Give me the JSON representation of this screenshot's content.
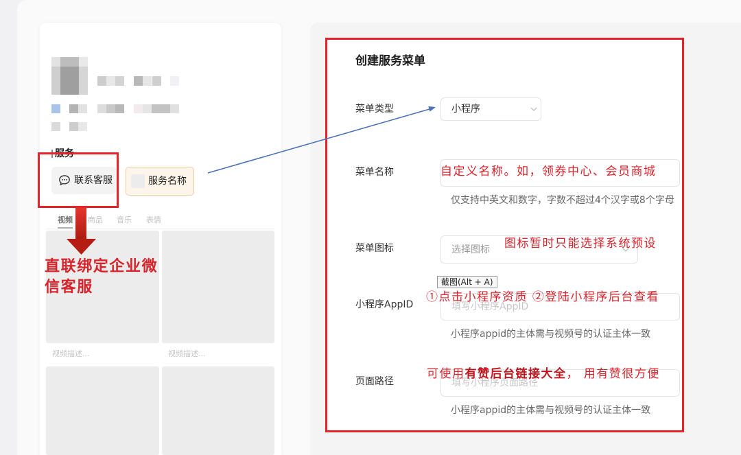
{
  "preview": {
    "section_title": "服务",
    "contact_button": {
      "label": "联系客服",
      "icon": "chat-bubble-icon"
    },
    "service_button": {
      "label": "服务名称",
      "icon": "image-placeholder-icon"
    },
    "tabs": [
      {
        "label": "视频",
        "active": true
      },
      {
        "label": "商品",
        "active": false
      },
      {
        "label": "音乐",
        "active": false
      },
      {
        "label": "表情",
        "active": false
      }
    ],
    "videos": [
      {
        "caption": "视频描述..."
      },
      {
        "caption": "视频描述..."
      }
    ]
  },
  "form": {
    "title": "创建服务菜单",
    "menu_type": {
      "label": "菜单类型",
      "value": "小程序"
    },
    "menu_name": {
      "label": "菜单名称",
      "hint": "仅支持中英文和数字，字数不超过4个汉字或8个字母"
    },
    "menu_icon": {
      "label": "菜单图标",
      "placeholder": "选择图标"
    },
    "appid": {
      "label": "小程序AppID",
      "placeholder": "填写小程序AppID",
      "hint": "小程序appid的主体需与视频号的认证主体一致"
    },
    "page_path": {
      "label": "页面路径",
      "placeholder": "填写小程序页面路径",
      "hint": "小程序appid的主体需与视频号的认证主体一致"
    }
  },
  "screenshot_tooltip": "截图(Alt + A)",
  "annotations": {
    "contact_note_lines": [
      "直联绑定企业微",
      "信客服"
    ],
    "name_note": "自定义名称。如，领券中心、会员商城",
    "icon_note": "图标暂时只能选择系统预设",
    "appid_note": "①点击小程序资质 ②登陆小程序后台查看",
    "path_note": {
      "before": "可使用",
      "bold": "有赞后台链接大全",
      "after": "， 用有赞很方便"
    }
  },
  "colors": {
    "annotation_red": "#d9232b",
    "annotation_red_strong": "#c0141c",
    "highlight_red": "#e3242b",
    "arrow_blue": "#4a72b8",
    "service_button_bg": "#fdf5ea",
    "service_button_border": "#f0cda6"
  }
}
